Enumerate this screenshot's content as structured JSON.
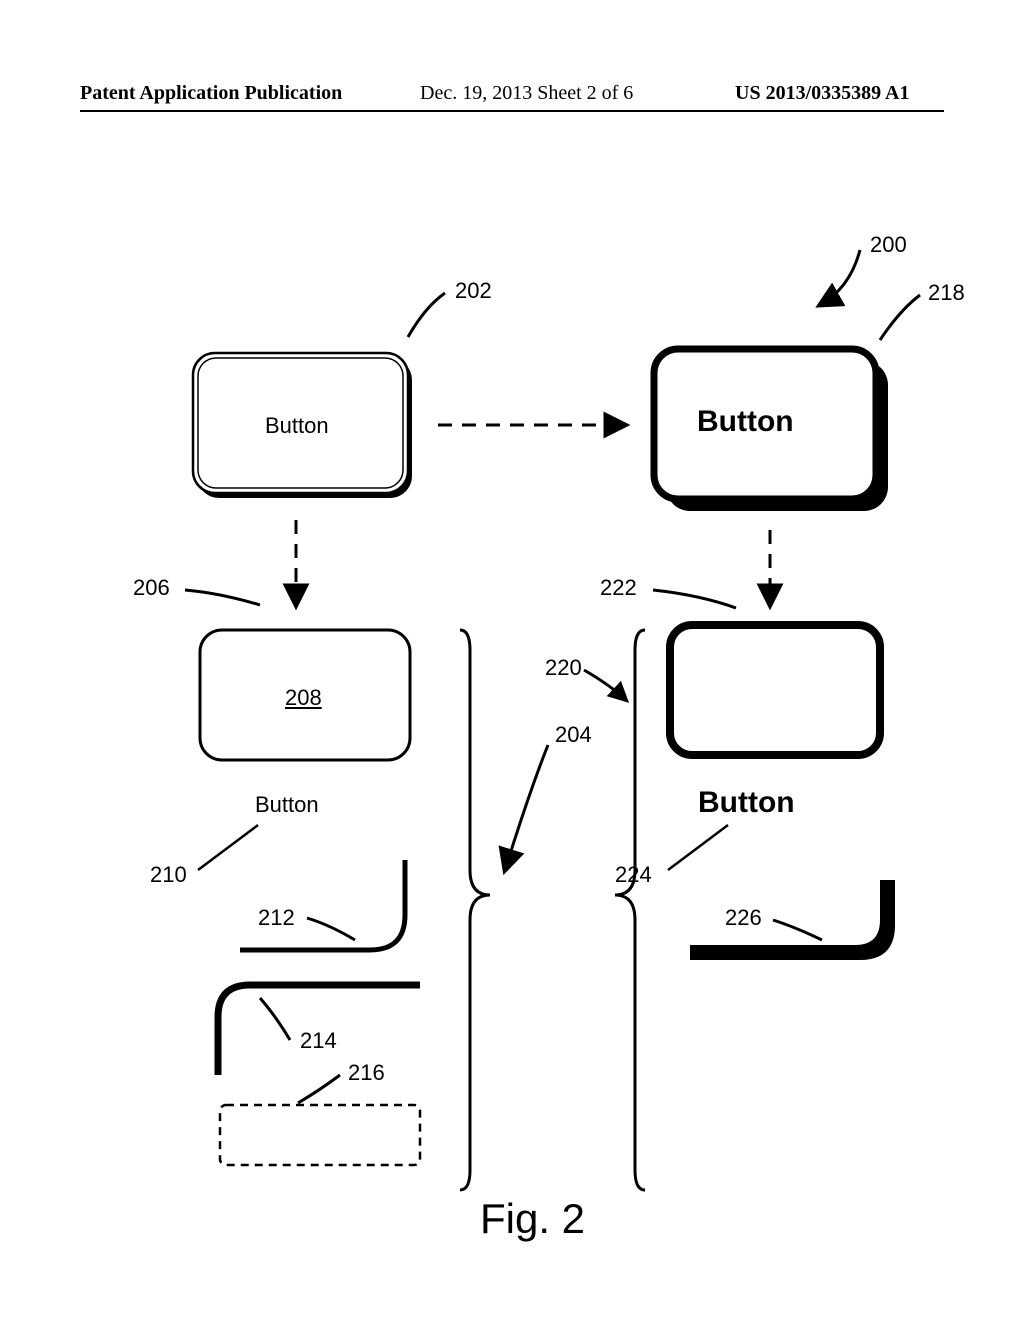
{
  "header": {
    "left": "Patent Application Publication",
    "center": "Dec. 19, 2013  Sheet 2 of 6",
    "right": "US 2013/0335389 A1"
  },
  "figure": {
    "caption": "Fig. 2",
    "labels": {
      "n200": "200",
      "n202": "202",
      "n204": "204",
      "n206": "206",
      "n208": "208",
      "n210": "210",
      "n212": "212",
      "n214": "214",
      "n216": "216",
      "n218": "218",
      "n220": "220",
      "n222": "222",
      "n224": "224",
      "n226": "226"
    },
    "text": {
      "button_plain": "Button",
      "button_label_208": "208",
      "button_label_plain2": "Button",
      "button_bold": "Button",
      "button_bold2": "Button"
    }
  }
}
